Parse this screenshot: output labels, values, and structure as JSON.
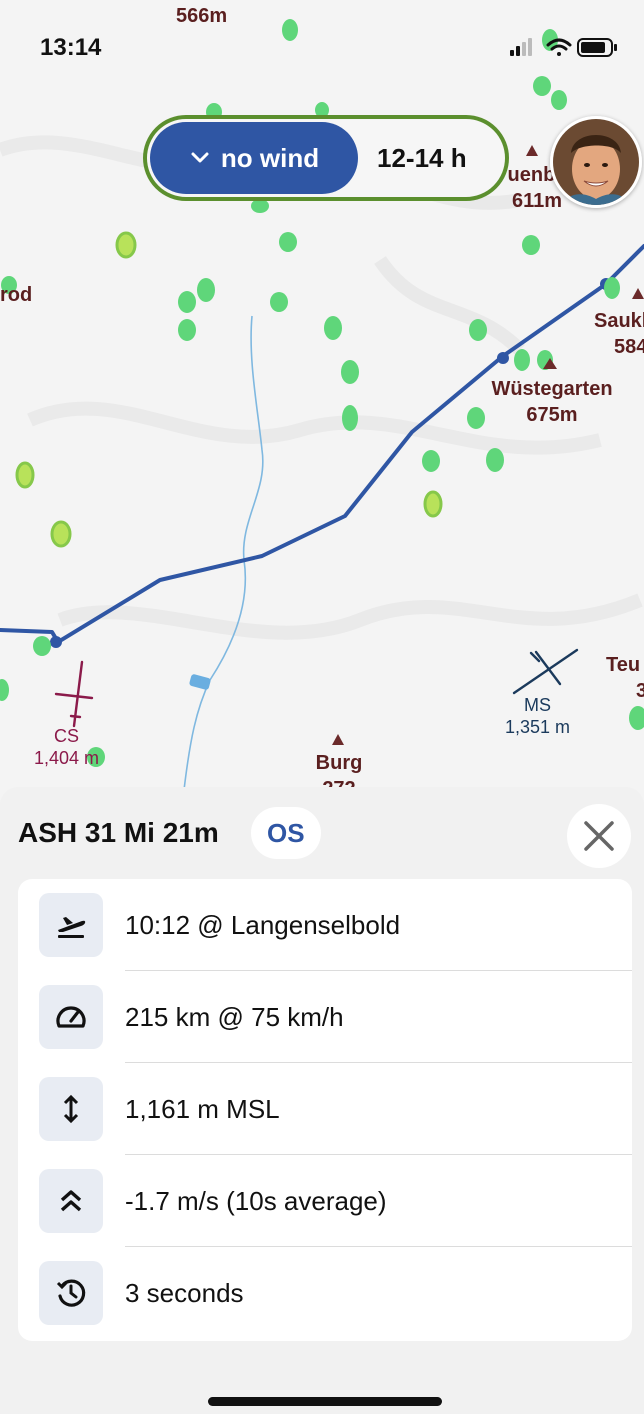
{
  "status_bar": {
    "time": "13:14"
  },
  "filter": {
    "wind_label": "no wind",
    "hours_label": "12-14 h"
  },
  "map_labels": {
    "top_elev": "566m",
    "p1_name": "uenbe",
    "p1_elev": "611m",
    "p2_name": "rod",
    "p3_name": "Saukl",
    "p3_elev": "584",
    "p4_name": "Wüstegarten",
    "p4_elev": "675m",
    "p5_name": "Teu",
    "p5_elev": "3",
    "p6_name": "Burg",
    "p6_elev": "272"
  },
  "aircraft": [
    {
      "id": "CS",
      "altitude": "1,404 m",
      "color": "#8b1a4a"
    },
    {
      "id": "MS",
      "altitude": "1,351 m",
      "color": "#1b3a5c"
    }
  ],
  "detail": {
    "title": "ASH 31 Mi 21m",
    "badge": "OS",
    "rows": [
      {
        "icon": "takeoff-icon",
        "text": "10:12 @ Langenselbold"
      },
      {
        "icon": "speedometer-icon",
        "text": "215 km @ 75 km/h"
      },
      {
        "icon": "vertical-arrows-icon",
        "text": "1,161 m MSL"
      },
      {
        "icon": "double-chevron-up-icon",
        "text": "-1.7 m/s (10s average)"
      },
      {
        "icon": "history-icon",
        "text": "3 seconds"
      }
    ]
  },
  "colors": {
    "track": "#2f56a4",
    "accent": "#2f56a4",
    "pill_border": "#5b8f2e",
    "thermal": "#5fd67a"
  }
}
